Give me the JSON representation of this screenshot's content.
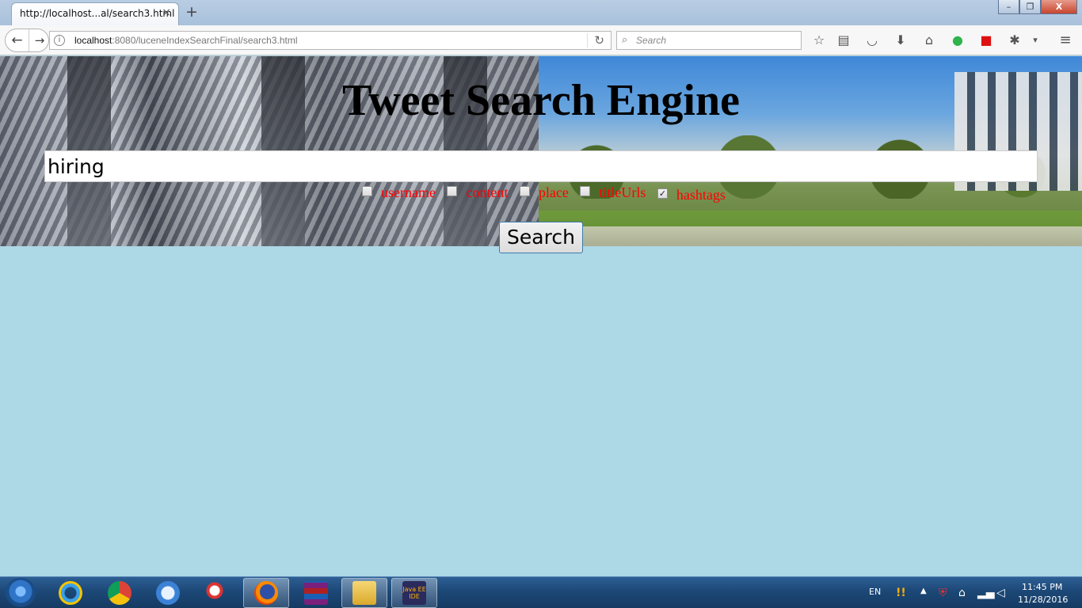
{
  "browser": {
    "tab_title": "http://localhost...al/search3.html",
    "tab_close": "×",
    "new_tab": "+",
    "url_host": "localhost",
    "url_rest": ":8080/luceneIndexSearchFinal/search3.html",
    "search_placeholder": "Search",
    "window_buttons": [
      "–",
      "❐",
      "X"
    ]
  },
  "page": {
    "title": "Tweet Search Engine",
    "query_value": "hiring",
    "fields": [
      {
        "label": "username",
        "checked": false
      },
      {
        "label": "content",
        "checked": false
      },
      {
        "label": "place",
        "checked": false
      },
      {
        "label": "titleUrls",
        "checked": false
      },
      {
        "label": "hashtags",
        "checked": true
      }
    ],
    "search_button": "Search"
  },
  "taskbar": {
    "language": "EN",
    "time": "11:45 PM",
    "date": "11/28/2016",
    "apps": [
      "internet-explorer",
      "chrome",
      "safari",
      "snipping-tool",
      "firefox",
      "winrar",
      "file-explorer",
      "java-ee-ide"
    ],
    "active_app": "firefox",
    "java_ee_badge": "Java EE IDE"
  },
  "colors": {
    "page_background": "#add8e6",
    "field_label": "#ff0000"
  }
}
